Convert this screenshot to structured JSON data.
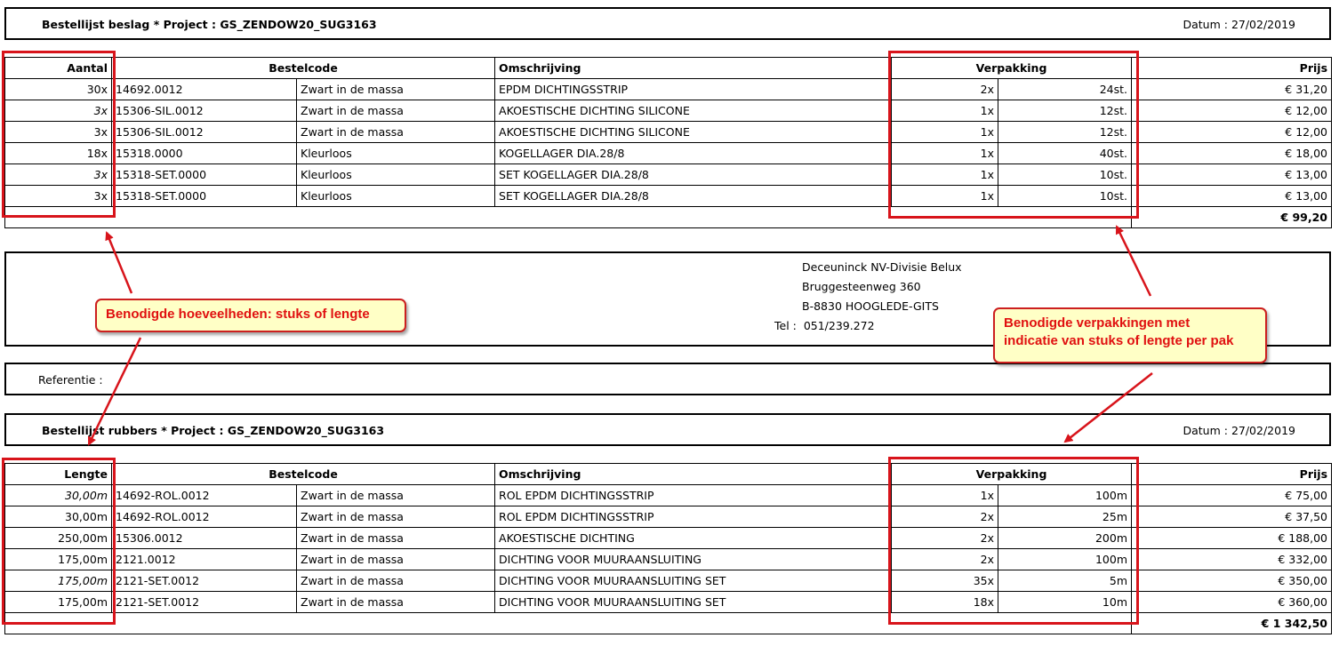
{
  "beslag": {
    "title": "Bestellijst beslag * Project : GS_ZENDOW20_SUG3163",
    "date": "Datum : 27/02/2019",
    "headers": {
      "qty": "Aantal",
      "code": "Bestelcode",
      "desc": "Omschrijving",
      "pack": "Verpakking",
      "price": "Prijs"
    },
    "rows": [
      {
        "qty": "30x",
        "code": "14692.0012",
        "color": "Zwart in de massa",
        "desc": "EPDM DICHTINGSSTRIP",
        "pack_count": "2x",
        "pack_size": "24st.",
        "price": "€ 31,20"
      },
      {
        "qty": "3x",
        "code": "15306-SIL.0012",
        "color": "Zwart in de massa",
        "desc": "AKOESTISCHE DICHTING SILICONE",
        "pack_count": "1x",
        "pack_size": "12st.",
        "price": "€ 12,00"
      },
      {
        "qty": "3x",
        "code": "15306-SIL.0012",
        "color": "Zwart in de massa",
        "desc": "AKOESTISCHE DICHTING SILICONE",
        "pack_count": "1x",
        "pack_size": "12st.",
        "price": "€ 12,00"
      },
      {
        "qty": "18x",
        "code": "15318.0000",
        "color": "Kleurloos",
        "desc": "KOGELLAGER DIA.28/8",
        "pack_count": "1x",
        "pack_size": "40st.",
        "price": "€ 18,00"
      },
      {
        "qty": "3x",
        "code": "15318-SET.0000",
        "color": "Kleurloos",
        "desc": "SET KOGELLAGER DIA.28/8",
        "pack_count": "1x",
        "pack_size": "10st.",
        "price": "€ 13,00"
      },
      {
        "qty": "3x",
        "code": "15318-SET.0000",
        "color": "Kleurloos",
        "desc": "SET KOGELLAGER DIA.28/8",
        "pack_count": "1x",
        "pack_size": "10st.",
        "price": "€ 13,00"
      }
    ],
    "total": "€ 99,20"
  },
  "supplier": {
    "name": "Deceuninck NV-Divisie Belux",
    "street": "Bruggesteenweg 360",
    "city": "B-8830 HOOGLEDE-GITS",
    "tel_label": "Tel :",
    "tel": "051/239.272"
  },
  "reference": {
    "label": "Referentie :"
  },
  "rubbers": {
    "title": "Bestellijst rubbers * Project : GS_ZENDOW20_SUG3163",
    "date": "Datum : 27/02/2019",
    "headers": {
      "qty": "Lengte",
      "code": "Bestelcode",
      "desc": "Omschrijving",
      "pack": "Verpakking",
      "price": "Prijs"
    },
    "rows": [
      {
        "qty": "30,00m",
        "code": "14692-ROL.0012",
        "color": "Zwart in de massa",
        "desc": "ROL EPDM DICHTINGSSTRIP",
        "pack_count": "1x",
        "pack_size": "100m",
        "price": "€ 75,00"
      },
      {
        "qty": "30,00m",
        "code": "14692-ROL.0012",
        "color": "Zwart in de massa",
        "desc": "ROL EPDM DICHTINGSSTRIP",
        "pack_count": "2x",
        "pack_size": "25m",
        "price": "€ 37,50"
      },
      {
        "qty": "250,00m",
        "code": "15306.0012",
        "color": "Zwart in de massa",
        "desc": "AKOESTISCHE DICHTING",
        "pack_count": "2x",
        "pack_size": "200m",
        "price": "€ 188,00"
      },
      {
        "qty": "175,00m",
        "code": "2121.0012",
        "color": "Zwart in de massa",
        "desc": "DICHTING VOOR MUURAANSLUITING",
        "pack_count": "2x",
        "pack_size": "100m",
        "price": "€ 332,00"
      },
      {
        "qty": "175,00m",
        "code": "2121-SET.0012",
        "color": "Zwart in de massa",
        "desc": "DICHTING VOOR MUURAANSLUITING SET",
        "pack_count": "35x",
        "pack_size": "5m",
        "price": "€ 350,00"
      },
      {
        "qty": "175,00m",
        "code": "2121-SET.0012",
        "color": "Zwart in de massa",
        "desc": "DICHTING VOOR MUURAANSLUITING SET",
        "pack_count": "18x",
        "pack_size": "10m",
        "price": "€ 360,00"
      }
    ],
    "total": "€ 1 342,50"
  },
  "callouts": {
    "quantities": "Benodigde hoeveelheden: stuks of lengte",
    "packaging_line1": "Benodigde verpakkingen met",
    "packaging_line2": "indicatie van stuks of lengte per pak"
  },
  "colors": {
    "highlight": "#d8141b",
    "callout_bg": "#ffffc6",
    "callout_text": "#e01010"
  }
}
